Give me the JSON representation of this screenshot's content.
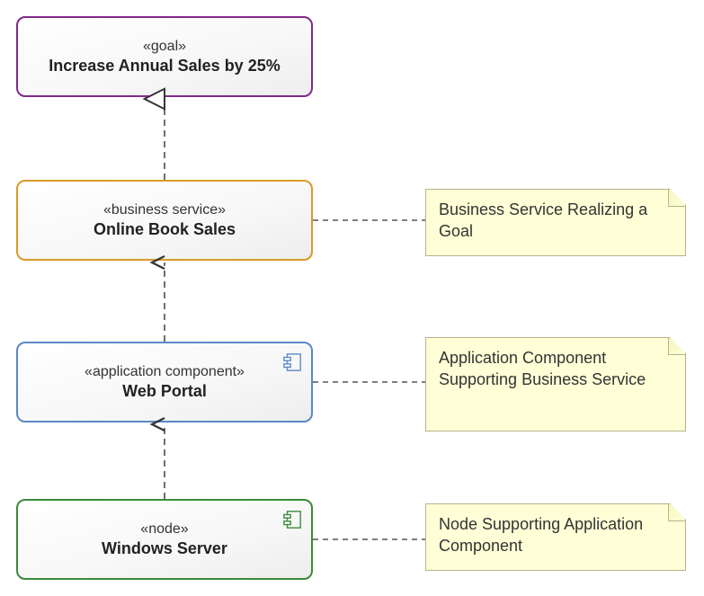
{
  "nodes": {
    "goal": {
      "stereo": "«goal»",
      "title": "Increase Annual Sales by 25%"
    },
    "bs": {
      "stereo": "«business service»",
      "title": "Online Book Sales"
    },
    "app": {
      "stereo": "«application component»",
      "title": "Web Portal"
    },
    "server": {
      "stereo": "«node»",
      "title": "Windows Server"
    }
  },
  "notes": {
    "bs": "Business Service Realizing a Goal",
    "app": "Application Component Supporting Business Service",
    "server": "Node Supporting Application Component"
  },
  "relations": [
    {
      "from": "bs",
      "to": "goal",
      "kind": "realization"
    },
    {
      "from": "app",
      "to": "bs",
      "kind": "dependency"
    },
    {
      "from": "server",
      "to": "app",
      "kind": "dependency"
    }
  ],
  "colors": {
    "goal": "#802a8a",
    "business_service": "#d99a2b",
    "application_component": "#5a88c6",
    "node": "#3a8a3a",
    "note_bg": "#feffd6",
    "note_border": "#b4b48a"
  }
}
